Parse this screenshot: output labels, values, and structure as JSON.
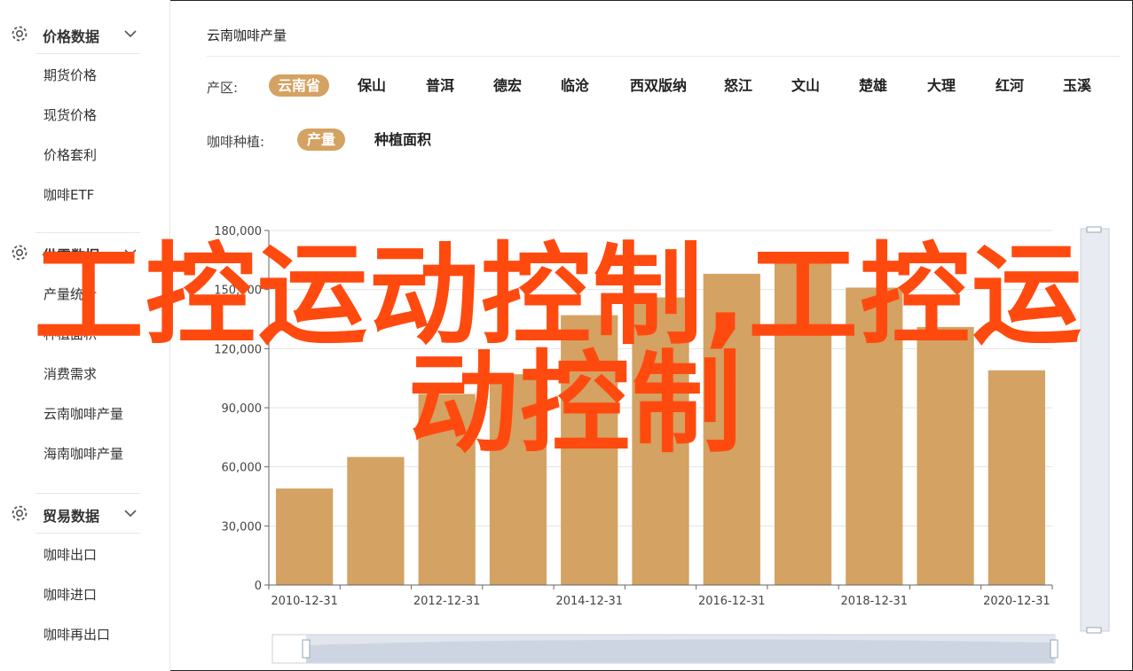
{
  "sidebar": {
    "groups": [
      {
        "title": "价格数据",
        "items": [
          "期货价格",
          "现货价格",
          "价格套利",
          "咖啡ETF"
        ]
      },
      {
        "title": "供需数据",
        "items": [
          "产量统计",
          "种植面积",
          "消费需求",
          "云南咖啡产量",
          "海南咖啡产量"
        ]
      },
      {
        "title": "贸易数据",
        "items": [
          "咖啡出口",
          "咖啡进口",
          "咖啡再出口"
        ]
      }
    ]
  },
  "header": {
    "title": "云南咖啡产量"
  },
  "filters": {
    "region_label": "产区:",
    "regions": [
      "云南省",
      "保山",
      "普洱",
      "德宏",
      "临沧",
      "西双版纳",
      "怒江",
      "文山",
      "楚雄",
      "大理",
      "红河",
      "玉溪"
    ],
    "region_selected": "云南省",
    "plant_label": "咖啡种植:",
    "plant_options": [
      "产量",
      "种植面积"
    ],
    "plant_selected": "产量"
  },
  "overlay": {
    "line1": "工控运动控制,工控运",
    "line2": "动控制",
    "color": "#ff4a0f"
  },
  "colors": {
    "bar": "#d4a262",
    "active_pill": "#d4a262",
    "slider": "#d5dbe6"
  },
  "chart_data": {
    "type": "bar",
    "categories": [
      "2010-12-31",
      "2011-12-31",
      "2012-12-31",
      "2013-12-31",
      "2014-12-31",
      "2015-12-31",
      "2016-12-31",
      "2017-12-31",
      "2018-12-31",
      "2019-12-31",
      "2020-12-31"
    ],
    "x_tick_labels": [
      "2010-12-31",
      "2012-12-31",
      "2014-12-31",
      "2016-12-31",
      "2018-12-31",
      "2020-12-31"
    ],
    "values": [
      49000,
      65000,
      97000,
      107000,
      137000,
      146000,
      158000,
      167000,
      151000,
      131000,
      109000
    ],
    "y_ticks": [
      0,
      30000,
      60000,
      90000,
      120000,
      150000,
      180000
    ],
    "y_tick_labels": [
      "0",
      "30,000",
      "60,000",
      "90,000",
      "120,000",
      "150,000",
      "180,000"
    ],
    "ylim": [
      0,
      180000
    ],
    "grid": true,
    "title": "",
    "xlabel": "",
    "ylabel": ""
  }
}
